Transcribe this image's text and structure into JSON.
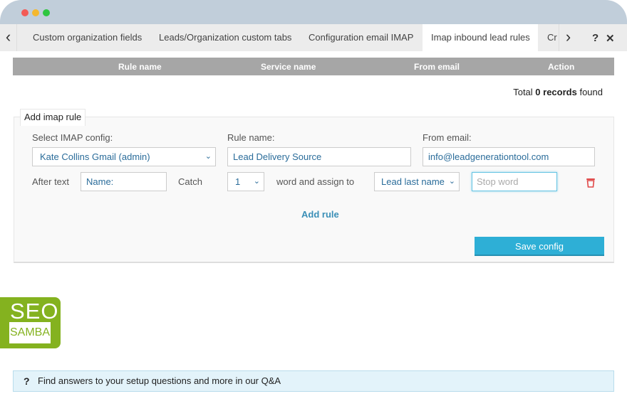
{
  "window": {
    "dots": [
      "#f35a55",
      "#f5b82e",
      "#2ec640"
    ]
  },
  "tabs": [
    {
      "label": "Custom organization fields",
      "active": false
    },
    {
      "label": "Leads/Organization custom tabs",
      "active": false
    },
    {
      "label": "Configuration email IMAP",
      "active": false
    },
    {
      "label": "Imap inbound lead rules",
      "active": true
    },
    {
      "label": "Cr",
      "active": false
    }
  ],
  "toolbar": {
    "help": "?",
    "close": "✕",
    "prev": "‹",
    "next": "›"
  },
  "table": {
    "columns": [
      "Rule name",
      "Service name",
      "From email",
      "Action"
    ]
  },
  "records": {
    "prefix": "Total ",
    "count": "0 records",
    "suffix": " found"
  },
  "form": {
    "legend": "Add imap rule",
    "imap_label": "Select IMAP config:",
    "imap_value": "Kate Collins Gmail (admin)",
    "rule_label": "Rule name:",
    "rule_value": "Lead Delivery Source",
    "from_label": "From email:",
    "from_value": "info@leadgenerationtool.com",
    "after_text_label": "After text",
    "after_text_value": "Name:",
    "catch_label": "Catch",
    "catch_value": "1",
    "assign_label": "word and assign to",
    "assign_value": "Lead last name",
    "stop_word_placeholder": "Stop word",
    "add_rule": "Add rule",
    "save": "Save config"
  },
  "logo": {
    "top": "SEO",
    "bottom": "SAMBA",
    "color": "#84b21f"
  },
  "qa": {
    "icon": "?",
    "text": "Find answers to your setup questions and more in our Q&A"
  },
  "colors": {
    "accent": "#2eafd6",
    "link": "#3a8fb7",
    "delete": "#e04848"
  }
}
